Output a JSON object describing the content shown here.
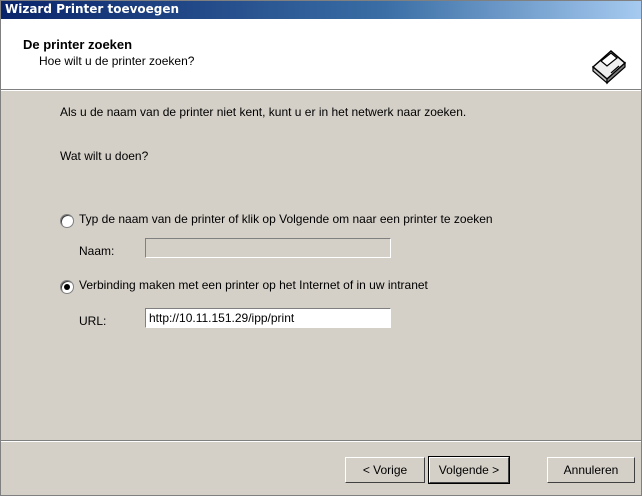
{
  "window": {
    "title": "Wizard Printer toevoegen"
  },
  "header": {
    "title": "De printer zoeken",
    "subtitle": "Hoe wilt u de printer zoeken?",
    "icon": "printer-icon"
  },
  "body": {
    "intro": "Als u de naam van de printer niet kent, kunt u er in het netwerk naar zoeken.",
    "question": "Wat wilt u doen?",
    "option_name": {
      "label": "Typ de naam van de printer of klik op Volgende om naar een printer te zoeken",
      "checked": false
    },
    "name_label": "Naam:",
    "name_value": "",
    "option_url": {
      "label": "Verbinding maken met een printer op het Internet of in uw intranet",
      "checked": true
    },
    "url_label": "URL:",
    "url_value": "http://10.11.151.29/ipp/print"
  },
  "buttons": {
    "back": "< Vorige",
    "next": "Volgende >",
    "cancel": "Annuleren"
  }
}
